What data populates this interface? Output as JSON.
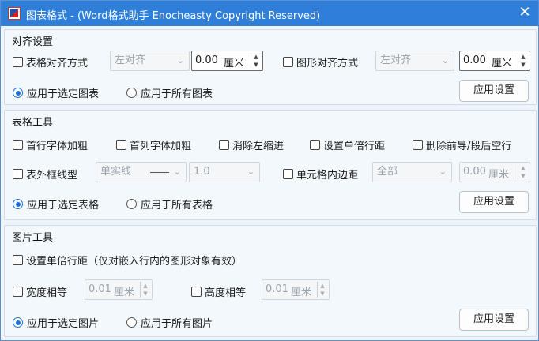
{
  "window": {
    "title": "图表格式 - (Word格式助手 Enocheasty Copyright Reserved)",
    "close_glyph": "✕"
  },
  "align": {
    "group_label": "对齐设置",
    "table_align_label": "表格对齐方式",
    "table_align_value": "左对齐",
    "table_offset_value": "0.00",
    "table_offset_unit": "厘米",
    "shape_align_label": "图形对齐方式",
    "shape_align_value": "左对齐",
    "shape_offset_value": "0.00",
    "shape_offset_unit": "厘米",
    "scope_selected": "应用于选定图表",
    "scope_all": "应用于所有图表",
    "scope_checked": "selected",
    "apply_label": "应用设置"
  },
  "table_tools": {
    "group_label": "表格工具",
    "first_row_bold": "首行字体加粗",
    "first_col_bold": "首列字体加粗",
    "clear_left_indent": "消除左缩进",
    "single_line_spacing": "设置单倍行距",
    "remove_blank_lines": "删除前导/段后空行",
    "outer_border_label": "表外框线型",
    "border_style_value": "单实线",
    "border_width_value": "1.0",
    "cell_padding_label": "单元格内边距",
    "cell_padding_scope": "全部",
    "cell_padding_value": "0.00",
    "cell_padding_unit": "厘米",
    "scope_selected": "应用于选定表格",
    "scope_all": "应用于所有表格",
    "scope_checked": "selected",
    "apply_label": "应用设置"
  },
  "image_tools": {
    "group_label": "图片工具",
    "single_spacing_label": "设置单倍行距（仅对嵌入行内的图形对象有效）",
    "equal_width_label": "宽度相等",
    "width_value": "0.01",
    "width_unit": "厘米",
    "equal_height_label": "高度相等",
    "height_value": "0.01",
    "height_unit": "厘米",
    "scope_selected": "应用于选定图片",
    "scope_all": "应用于所有图片",
    "scope_checked": "selected",
    "apply_label": "应用设置"
  },
  "colors": {
    "titlebar": "#2f7fd8",
    "accent": "#1a6fd8"
  }
}
